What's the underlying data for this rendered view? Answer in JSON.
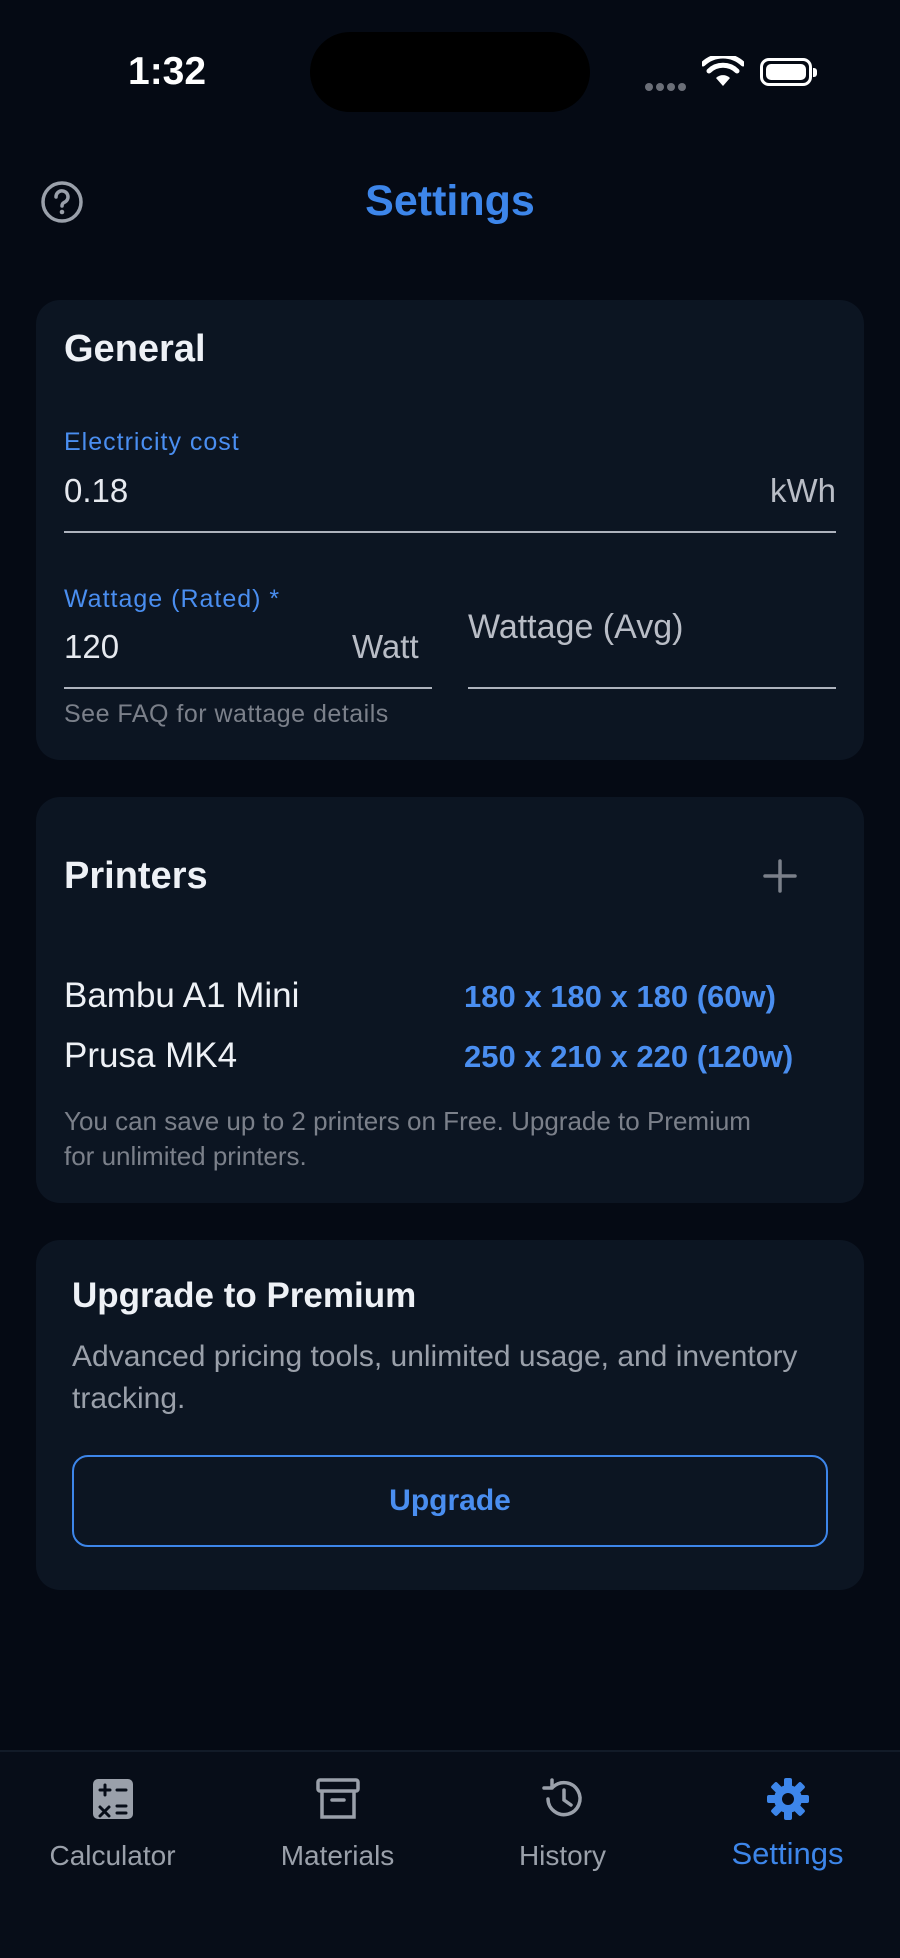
{
  "status_bar": {
    "time": "1:32"
  },
  "header": {
    "title": "Settings",
    "help_icon": "help-circle-icon"
  },
  "general": {
    "title": "General",
    "electricity": {
      "label": "Electricity cost",
      "value": "0.18",
      "suffix": "kWh"
    },
    "wattage_rated": {
      "label": "Wattage (Rated) *",
      "value": "120",
      "suffix": "Watt"
    },
    "wattage_avg": {
      "placeholder": "Wattage (Avg)"
    },
    "helper": "See FAQ for wattage details"
  },
  "printers": {
    "title": "Printers",
    "add_icon": "plus-icon",
    "items": [
      {
        "name": "Bambu A1 Mini",
        "spec": "180 x 180 x 180 (60w)"
      },
      {
        "name": "Prusa MK4",
        "spec": "250 x 210 x 220 (120w)"
      }
    ],
    "note": "You can save up to 2 printers on Free. Upgrade to Premium for unlimited printers."
  },
  "premium": {
    "title": "Upgrade to Premium",
    "description": "Advanced pricing tools, unlimited usage, and inventory tracking.",
    "button": "Upgrade"
  },
  "tabs": [
    {
      "label": "Calculator",
      "icon": "calculator-icon",
      "active": false
    },
    {
      "label": "Materials",
      "icon": "archive-box-icon",
      "active": false
    },
    {
      "label": "History",
      "icon": "history-icon",
      "active": false
    },
    {
      "label": "Settings",
      "icon": "gear-icon",
      "active": true
    }
  ],
  "colors": {
    "accent": "#3d86ea",
    "background": "#050a14",
    "card": "#0c1522"
  }
}
